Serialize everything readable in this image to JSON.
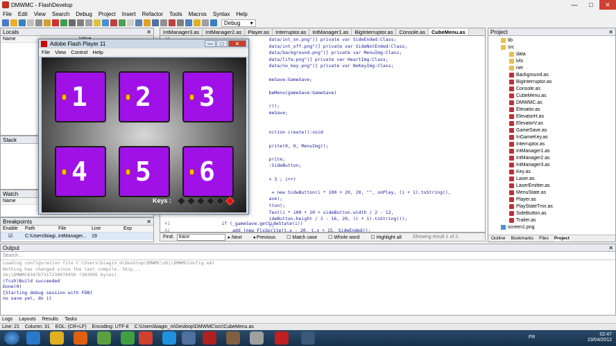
{
  "window": {
    "title": "DMWMC - FlashDevelop",
    "min": "—",
    "max": "□",
    "close": "✕"
  },
  "menu": [
    "File",
    "Edit",
    "View",
    "Search",
    "Debug",
    "Project",
    "Insert",
    "Refactor",
    "Tools",
    "Macros",
    "Syntax",
    "Help"
  ],
  "toolbar": {
    "config": "Debug"
  },
  "locals": {
    "title": "Locals",
    "col_name": "Name",
    "col_value": "Value"
  },
  "stack": {
    "title": "Stack"
  },
  "watch": {
    "title": "Watch",
    "col_name": "Name"
  },
  "breakpoints": {
    "title": "Breakpoints",
    "cols": [
      "Enable",
      "Path",
      "File",
      "Line",
      "Exp"
    ],
    "row": {
      "path": "C:\\Users\\biagi...",
      "file": "IntManager...",
      "line": "19"
    }
  },
  "tabs": [
    "IntManager3.as",
    "IntManager2.as",
    "Player.as",
    "Interruptor.as",
    "IntManager1.as",
    "BigInterruptor.as",
    "Console.as",
    "CubeMenu.as"
  ],
  "active_tab": "CubeMenu.as",
  "code": {
    "line1_num": "10",
    "lines": [
      "                                        data/int_on.png\")] private var SideEnded:Class;",
      "                                        data/int_off.png\")] private var SideNotEnded:Class;",
      "                                        data/background.png\")] private var MenuImg:Class;",
      "                                        data/life.png\")] private var HeartImg:Class;",
      "                                        data/no_key.png\")] private var NoKeyImg:Class;",
      "",
      "                                        meSave:GameSave;",
      "",
      "                                        beMenu(gameSave:GameSave)",
      "",
      "                                        r();",
      "                                        meSave;",
      "",
      "",
      "                                        nction create():void",
      "",
      "                                        prite(0, 0, MenuImg));",
      "",
      "                                        prite;",
      "                                        :SideButton;",
      "",
      "                                        < 3 ; i++)",
      "",
      "                                         = new SideButton(i * 100 + 20, 20, \"\", onPlay, (i + 1).toString(),",
      "                                        ave);",
      "                                        tton);",
      "                                        Text(i * 100 + 20 + sideButton.width / 2 - 12,",
      "                                        ideButton.height / 2 - 16, 20, (i + 1).toString());",
      "                                        );"
    ],
    "l41": "                   if (_gameSave.getSideState(i))",
    "l42": "                       add (new FlxSprite(t.x - 20, t.y + 15, SideEnded));",
    "n41": "41",
    "n42": "42"
  },
  "find": {
    "label": "Find:",
    "value": "trace",
    "next": "Next",
    "previous": "Previous",
    "match_case": "Match case",
    "whole_word": "Whole word",
    "highlight": "Highlight all",
    "result": "Showing result 1 of 2."
  },
  "project": {
    "title": "Project",
    "items": [
      {
        "name": "lib",
        "level": 1,
        "type": "folder"
      },
      {
        "name": "src",
        "level": 1,
        "type": "folder"
      },
      {
        "name": "data",
        "level": 2,
        "type": "folder"
      },
      {
        "name": "lvls",
        "level": 2,
        "type": "folder"
      },
      {
        "name": "net",
        "level": 2,
        "type": "folder"
      },
      {
        "name": "Background.as",
        "level": 2,
        "type": "file"
      },
      {
        "name": "BigInterruptor.as",
        "level": 2,
        "type": "file"
      },
      {
        "name": "Console.as",
        "level": 2,
        "type": "file"
      },
      {
        "name": "CubeMenu.as",
        "level": 2,
        "type": "file"
      },
      {
        "name": "DMWMC.as",
        "level": 2,
        "type": "file"
      },
      {
        "name": "Elevator.as",
        "level": 2,
        "type": "file"
      },
      {
        "name": "ElevatorH.as",
        "level": 2,
        "type": "file"
      },
      {
        "name": "ElevatorV.as",
        "level": 2,
        "type": "file"
      },
      {
        "name": "GameSave.as",
        "level": 2,
        "type": "file"
      },
      {
        "name": "InGameKey.as",
        "level": 2,
        "type": "file"
      },
      {
        "name": "Interruptor.as",
        "level": 2,
        "type": "file"
      },
      {
        "name": "IntManager1.as",
        "level": 2,
        "type": "file"
      },
      {
        "name": "IntManager2.as",
        "level": 2,
        "type": "file"
      },
      {
        "name": "IntManager3.as",
        "level": 2,
        "type": "file"
      },
      {
        "name": "Key.as",
        "level": 2,
        "type": "file"
      },
      {
        "name": "Laser.as",
        "level": 2,
        "type": "file"
      },
      {
        "name": "LaserEmitter.as",
        "level": 2,
        "type": "file"
      },
      {
        "name": "MenuState.as",
        "level": 2,
        "type": "file"
      },
      {
        "name": "Player.as",
        "level": 2,
        "type": "file"
      },
      {
        "name": "PlayStateTmx.as",
        "level": 2,
        "type": "file"
      },
      {
        "name": "SideButton.as",
        "level": 2,
        "type": "file"
      },
      {
        "name": "Trailer.as",
        "level": 2,
        "type": "file"
      },
      {
        "name": "screen1.png",
        "level": 1,
        "type": "image"
      }
    ],
    "tabs": [
      "Outline",
      "Bookmarks",
      "Files",
      "Project"
    ]
  },
  "output": {
    "title": "Output",
    "search_placeholder": "Search...",
    "lines": [
      "Loading configuration file C:\\Users\\biagin_m\\Desktop\\DMWMC\\obj\\DMWMCConfig.xml",
      "Nothing has changed since the last compile. Skip...",
      "obj\\DMWMC634707317239070450 (383995 bytes)",
      "(fcsh)Build succeeded",
      "Done(0)",
      "[Starting debug session with FDB]",
      "no save yet, do it"
    ]
  },
  "bottom_tabs": [
    "Logs",
    "Layouts",
    "Results",
    "Tasks"
  ],
  "status": {
    "line": "Line: 21",
    "column": "Column: 31",
    "eol": "EOL: (CR+LF)",
    "encoding": "Encoding: UTF-8",
    "path": "C:\\Users\\biagin_m\\Desktop\\DMWMC\\src\\CubeMenu.as"
  },
  "taskbar": {
    "lang": "FR",
    "time": "02:47",
    "date": "23/04/2012"
  },
  "flash": {
    "title": "Adobe Flash Player 11",
    "menu": [
      "File",
      "View",
      "Control",
      "Help"
    ],
    "cubes": [
      "1",
      "2",
      "3",
      "4",
      "5",
      "6"
    ],
    "keys_label": "Keys :",
    "keys_total": 6,
    "keys_red_index": 5
  },
  "colors": {
    "cube": "#a011e8",
    "accent": "#e01010"
  }
}
